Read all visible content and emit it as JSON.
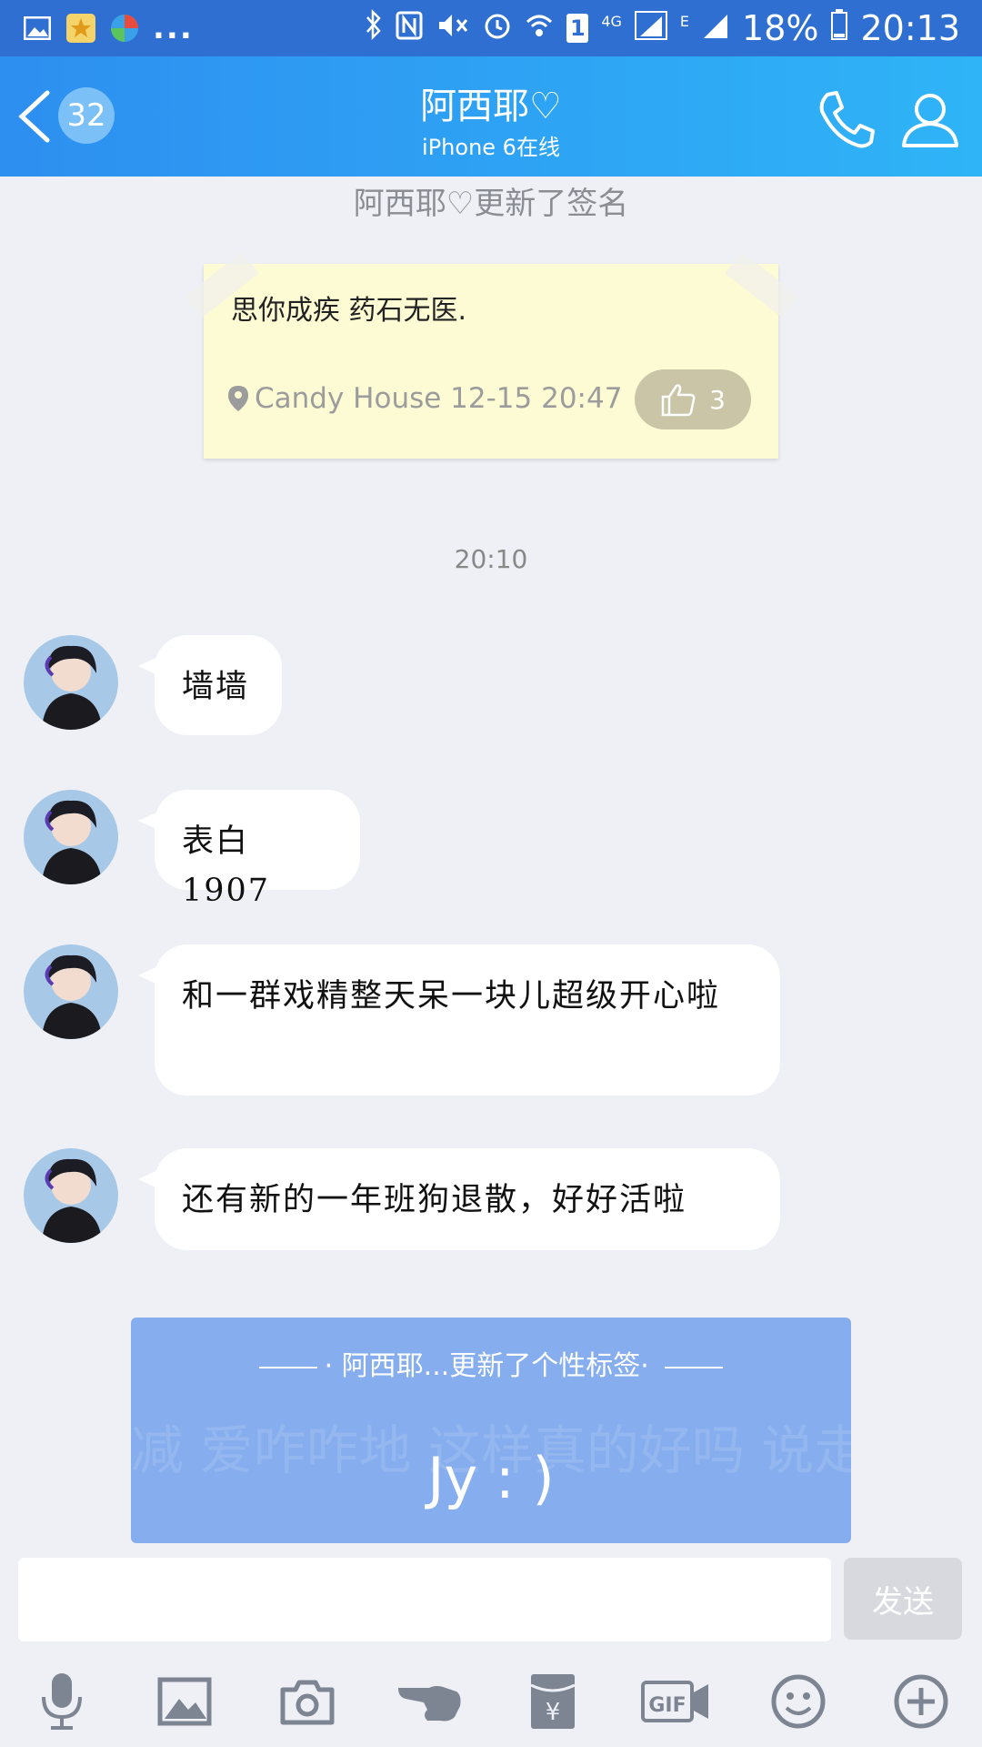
{
  "status_bar": {
    "more": "...",
    "battery_percent": "18%",
    "time": "20:13",
    "sim": "1",
    "network_4g": "4G",
    "network_e": "E"
  },
  "header": {
    "unread_count": "32",
    "title": "阿西耶♡",
    "subtitle": "iPhone 6在线"
  },
  "notice_signature": "阿西耶♡更新了签名",
  "note_card": {
    "text": "思你成疾  药石无医.",
    "location_time": "Candy House 12-15 20:47",
    "likes": "3"
  },
  "timestamp": "20:10",
  "messages": [
    {
      "text": "墙墙"
    },
    {
      "text": "表白1907"
    },
    {
      "text": "和一群戏精整天呆一块儿超级开心啦"
    },
    {
      "text": "还有新的一年班狗退散，好好活啦"
    }
  ],
  "tag_card": {
    "title": "阿西耶...更新了个性标签",
    "tag": "Jy : )",
    "background_text": "减 爱咋咋地 这样真的好吗 说走就走的旅行 没错 正能量 哦 肥 不成熟的小建 爱咋咋地 肥燥燥燥起来"
  },
  "input": {
    "placeholder": "",
    "send_label": "发送"
  },
  "toolbar": {
    "items": [
      "mic-icon",
      "image-icon",
      "camera-icon",
      "poke-icon",
      "red-packet-icon",
      "gif-icon",
      "emoji-icon",
      "plus-icon"
    ],
    "gif_label": "GIF"
  },
  "colors": {
    "status_bar": "#2e6fd1",
    "header_start": "#2d8ff0",
    "header_end": "#2fb4f7",
    "background": "#eef0f6",
    "note": "#fdfbd3",
    "tag_card": "#86aeee"
  }
}
